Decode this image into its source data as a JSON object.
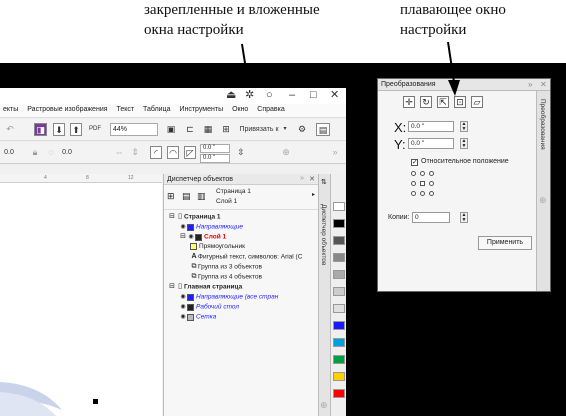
{
  "captions": {
    "left_line1": "закрепленные и вложенные",
    "left_line2": "окна настройки",
    "right_line1": "плавающее окно",
    "right_line2": "настройки"
  },
  "menu": [
    "екты",
    "Растровые изображения",
    "Текст",
    "Таблица",
    "Инструменты",
    "Окно",
    "Справка"
  ],
  "toolbar": {
    "zoom": "44%",
    "snap_label": "Привязать к",
    "pos_x": "0.0",
    "pos_y": "0.0",
    "rot_a": "0.0 \"",
    "rot_b": "0.0 \""
  },
  "object_manager": {
    "title": "Диспетчер объектов",
    "page_label": "Страница 1",
    "layer_label": "Слой 1",
    "side_tab": "Диспетчер объектов",
    "tree": [
      {
        "indent": 0,
        "label": "Страница 1",
        "bold": true,
        "icon": "page-icon"
      },
      {
        "indent": 1,
        "label": "Направляющие",
        "italic": true,
        "color": "#1e1eff",
        "swatch": "#1e1eff"
      },
      {
        "indent": 1,
        "label": "Слой 1",
        "bold": true,
        "color": "#e00000",
        "swatch": "#222222"
      },
      {
        "indent": 2,
        "label": "Прямоугольник",
        "swatch": "#ffff66"
      },
      {
        "indent": 2,
        "label": "Фигурный текст, символов: Arial (C",
        "icon": "text-icon"
      },
      {
        "indent": 2,
        "label": "Группа из 3 объектов",
        "icon": "group-icon"
      },
      {
        "indent": 2,
        "label": "Группа из 4 объектов",
        "icon": "group-icon"
      },
      {
        "indent": 0,
        "label": "Главная страница",
        "bold": true,
        "icon": "page-icon"
      },
      {
        "indent": 1,
        "label": "Направляющие (все стран",
        "italic": true,
        "color": "#1e1eff",
        "swatch": "#1e1eff"
      },
      {
        "indent": 1,
        "label": "Рабочий стол",
        "italic": true,
        "color": "#1e1eff",
        "swatch": "#222222"
      },
      {
        "indent": 1,
        "label": "Сетка",
        "italic": true,
        "color": "#1e1eff",
        "swatch": "#bbbbbb"
      }
    ]
  },
  "palette": [
    "#ffffff",
    "#000000",
    "#555555",
    "#888888",
    "#aaaaaa",
    "#cccccc",
    "#e0e0e0",
    "#1a1aff",
    "#00a0e0",
    "#00a040",
    "#ffd000",
    "#ff0000"
  ],
  "transform": {
    "title": "Преобразования",
    "side_tab": "Преобразования",
    "x_label": "X:",
    "x_value": "0.0 \"",
    "y_label": "Y:",
    "y_value": "0.0 \"",
    "relative_label": "Относительное положение",
    "relative_checked": true,
    "copies_label": "Копии:",
    "copies_value": "0",
    "apply_label": "Применить"
  }
}
